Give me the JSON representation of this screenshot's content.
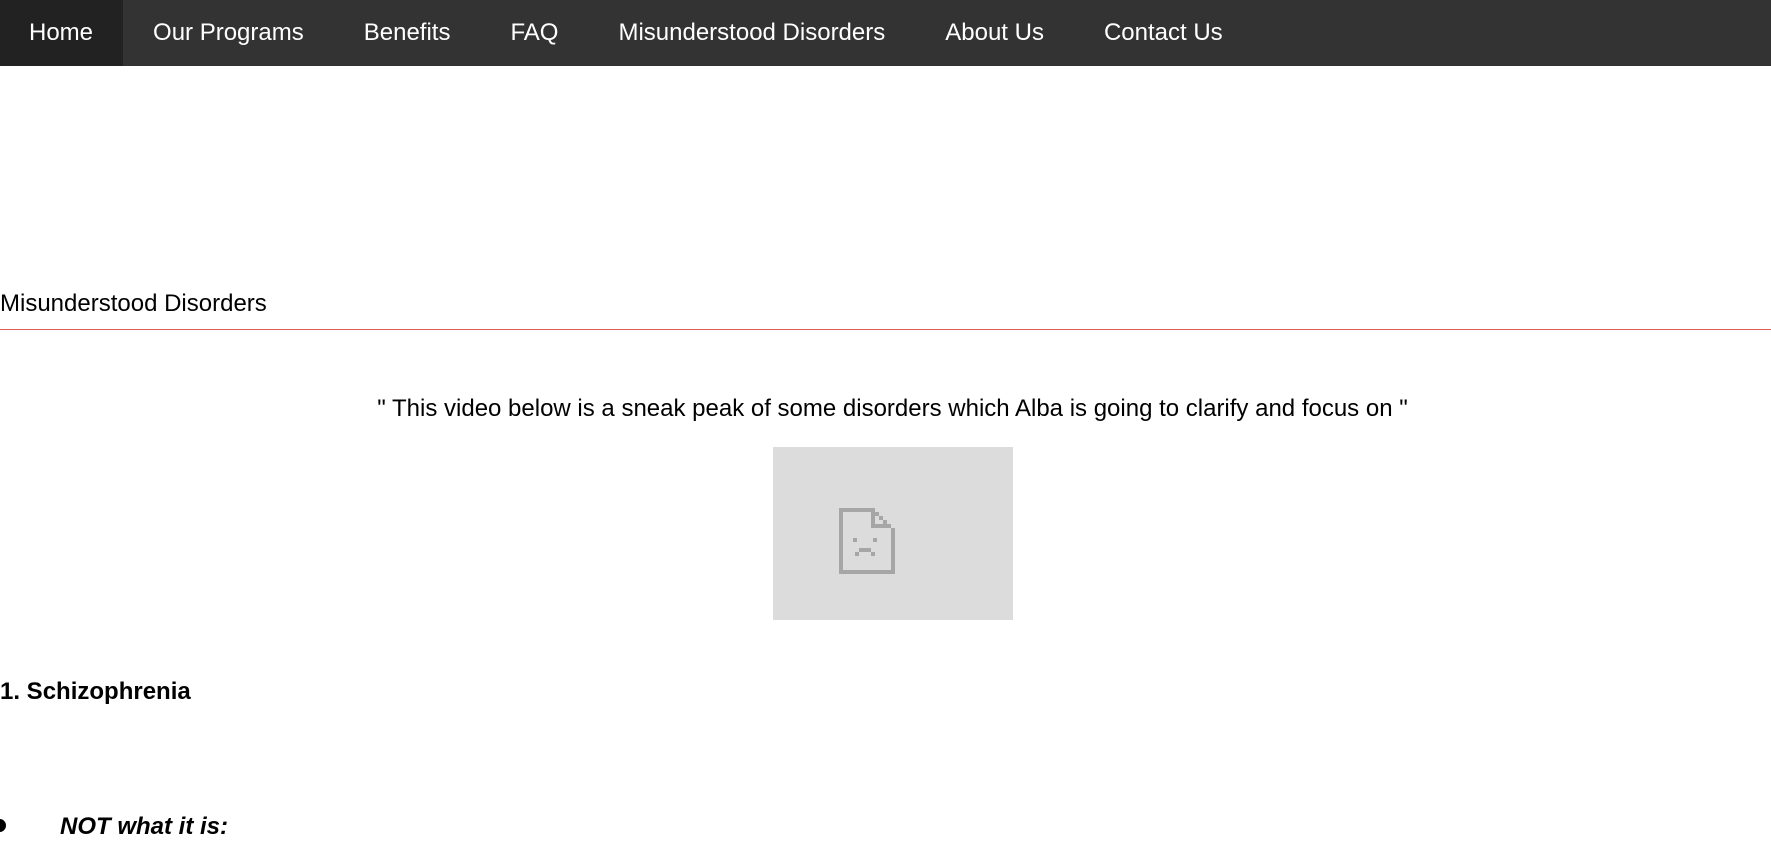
{
  "nav": {
    "items": [
      {
        "label": "Home"
      },
      {
        "label": "Our Programs"
      },
      {
        "label": "Benefits"
      },
      {
        "label": "FAQ"
      },
      {
        "label": "Misunderstood Disorders"
      },
      {
        "label": "About Us"
      },
      {
        "label": "Contact Us"
      }
    ],
    "background": "#333333",
    "text_color": "#ffffff"
  },
  "page": {
    "section_title": "Misunderstood Disorders",
    "rule_color": "#e05a5a",
    "quote": "\" This video below is a sneak peak of some disorders which Alba is going to clarify and focus on \"",
    "video": {
      "icon": "broken-file-icon",
      "background": "#dcdcdc"
    },
    "disorders": [
      {
        "heading": "1. Schizophrenia",
        "subheading": "NOT what it is:"
      }
    ]
  }
}
